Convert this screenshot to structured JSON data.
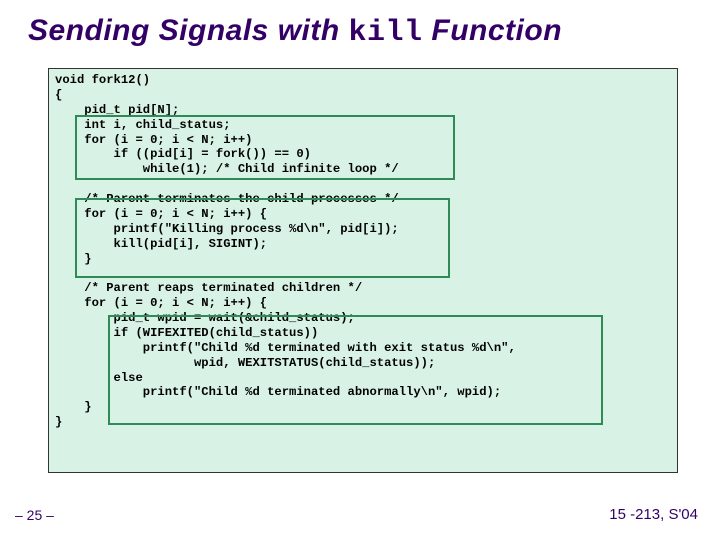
{
  "title": {
    "pre": "Sending Signals with ",
    "mono": "kill",
    "post": " Function"
  },
  "code": "void fork12()\n{\n    pid_t pid[N];\n    int i, child_status;\n    for (i = 0; i < N; i++)\n        if ((pid[i] = fork()) == 0)\n            while(1); /* Child infinite loop */\n\n    /* Parent terminates the child processes */\n    for (i = 0; i < N; i++) {\n        printf(\"Killing process %d\\n\", pid[i]);\n        kill(pid[i], SIGINT);\n    }\n\n    /* Parent reaps terminated children */\n    for (i = 0; i < N; i++) {\n        pid_t wpid = wait(&child_status);\n        if (WIFEXITED(child_status))\n            printf(\"Child %d terminated with exit status %d\\n\",\n                   wpid, WEXITSTATUS(child_status));\n        else\n            printf(\"Child %d terminated abnormally\\n\", wpid);\n    }\n}",
  "footer": {
    "left": "– 25 –",
    "right": "15 -213, S'04"
  }
}
